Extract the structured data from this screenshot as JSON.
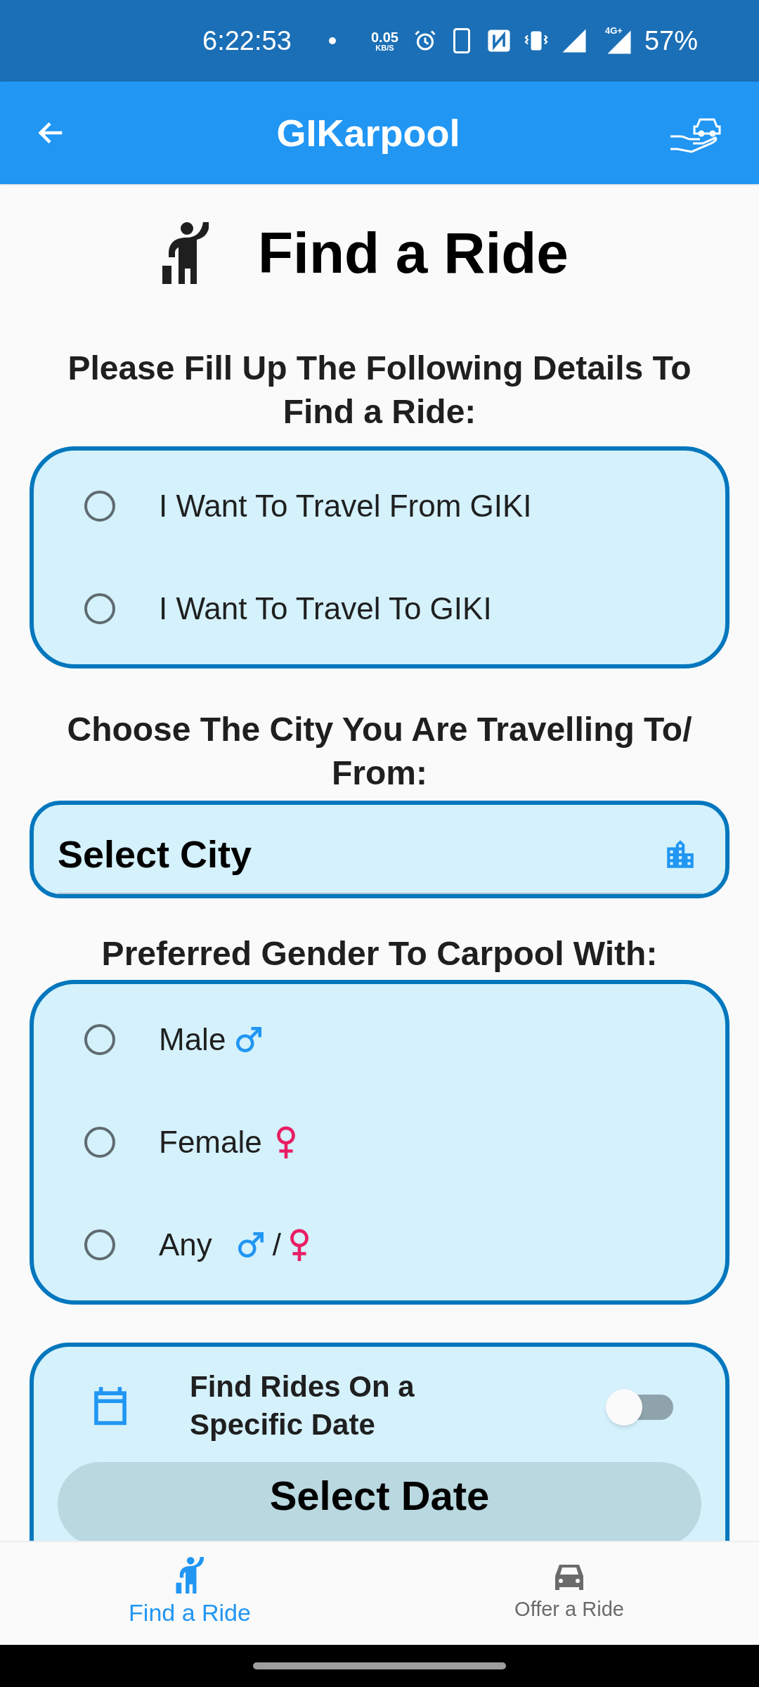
{
  "status_bar": {
    "time": "6:22:53",
    "speed": "0.05",
    "speed_unit": "KB/S",
    "network": "4G+",
    "battery": "57%"
  },
  "app_bar": {
    "title": "GIKarpool"
  },
  "page_title": "Find a Ride",
  "direction": {
    "heading": "Please Fill Up The Following Details To Find a Ride:",
    "options": [
      {
        "label": "I Want To Travel From GIKI",
        "selected": false
      },
      {
        "label": "I Want To Travel To GIKI",
        "selected": false
      }
    ]
  },
  "city": {
    "heading": "Choose The City You Are Travelling To/ From:",
    "placeholder": "Select City"
  },
  "gender": {
    "heading": "Preferred Gender To Carpool With:",
    "options": [
      {
        "label": "Male",
        "kind": "male",
        "selected": false
      },
      {
        "label": "Female",
        "kind": "female",
        "selected": false
      },
      {
        "label": "Any",
        "kind": "any",
        "separator": "/",
        "selected": false
      }
    ]
  },
  "date": {
    "label": "Find Rides On a Specific Date",
    "on": false,
    "button": "Select Date"
  },
  "bottom_nav": [
    {
      "label": "Find a Ride",
      "selected": true
    },
    {
      "label": "Offer a Ride",
      "selected": false
    }
  ]
}
